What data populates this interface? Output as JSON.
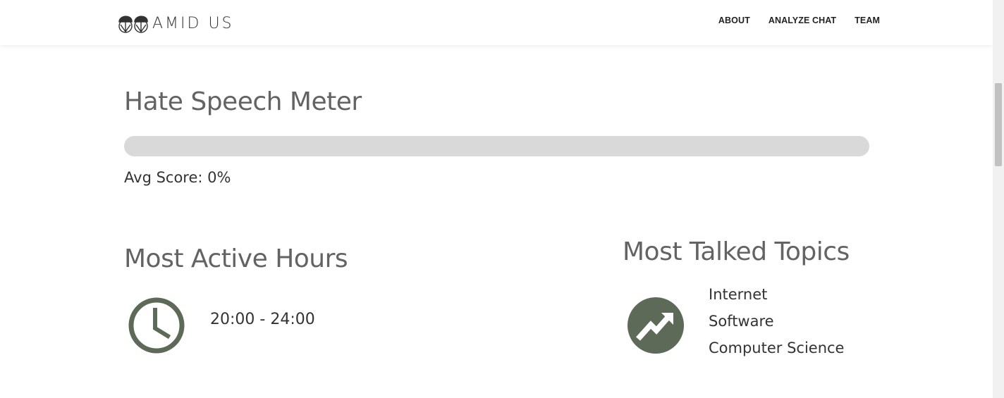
{
  "header": {
    "brand": "AMID US",
    "nav": [
      {
        "label": "ABOUT"
      },
      {
        "label": "ANALYZE CHAT"
      },
      {
        "label": "TEAM"
      }
    ]
  },
  "hate_meter": {
    "title": "Hate Speech Meter",
    "avg_score_text": "Avg Score: 0%",
    "level_percent": 0
  },
  "active_hours": {
    "title": "Most Active Hours",
    "icon": "clock-icon",
    "value": "20:00 - 24:00"
  },
  "topics": {
    "title": "Most Talked Topics",
    "icon": "trending-up-icon",
    "items": [
      "Internet",
      "Software",
      "Computer Science"
    ]
  },
  "colors": {
    "heading": "#636363",
    "icon_fill": "#5d6a57",
    "meter_track": "#d9d9d9",
    "text": "#333333"
  }
}
